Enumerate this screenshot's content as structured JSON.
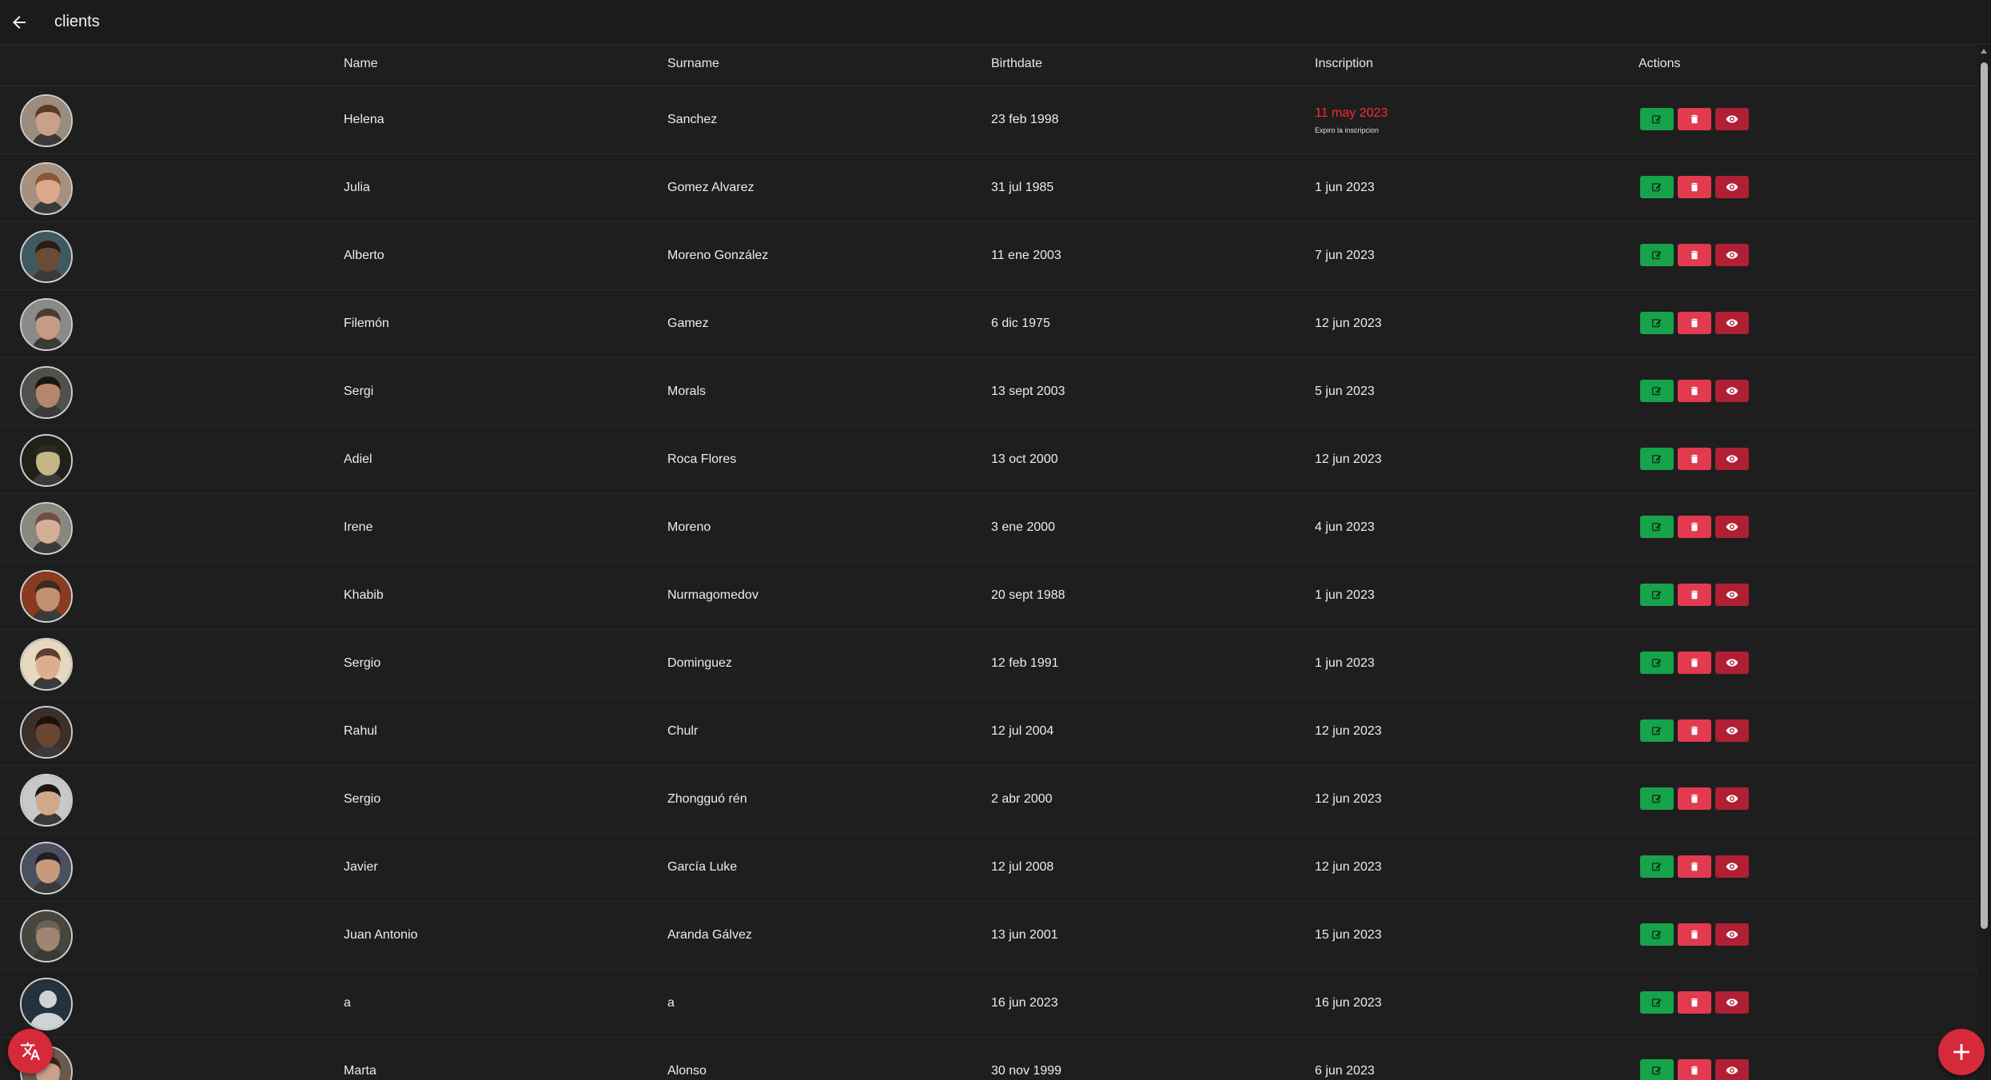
{
  "header": {
    "title": "clients",
    "back_icon": "arrow-left-icon"
  },
  "table": {
    "columns": [
      "Name",
      "Surname",
      "Birthdate",
      "Inscription",
      "Actions"
    ],
    "rows": [
      {
        "name": "Helena",
        "surname": "Sanchez",
        "birthdate": "23 feb 1998",
        "inscription": "11 may 2023",
        "expired": true,
        "note": "Expiro la inscripcion",
        "skin": "#c9a089",
        "hair": "#5a3a22",
        "bg": "#9c8c7e"
      },
      {
        "name": "Julia",
        "surname": "Gomez Alvarez",
        "birthdate": "31 jul 1985",
        "inscription": "1 jun 2023",
        "expired": false,
        "note": "",
        "skin": "#d9a98c",
        "hair": "#8a5a32",
        "bg": "#a5917d"
      },
      {
        "name": "Alberto",
        "surname": "Moreno González",
        "birthdate": "11 ene 2003",
        "inscription": "7 jun 2023",
        "expired": false,
        "note": "",
        "skin": "#6d4a36",
        "hair": "#2a1c14",
        "bg": "#3e5a60"
      },
      {
        "name": "Filemón",
        "surname": "Gamez",
        "birthdate": "6 dic 1975",
        "inscription": "12 jun 2023",
        "expired": false,
        "note": "",
        "skin": "#c79a82",
        "hair": "#4a3a30",
        "bg": "#8a8a88"
      },
      {
        "name": "Sergi",
        "surname": "Morals",
        "birthdate": "13 sept 2003",
        "inscription": "5 jun 2023",
        "expired": false,
        "note": "",
        "skin": "#b5876a",
        "hair": "#1c1410",
        "bg": "#50504c"
      },
      {
        "name": "Adiel",
        "surname": "Roca Flores",
        "birthdate": "13 oct 2000",
        "inscription": "12 jun 2023",
        "expired": false,
        "note": "",
        "skin": "#c4b486",
        "hair": "#2a2a22",
        "bg": "#1e2218"
      },
      {
        "name": "Irene",
        "surname": "Moreno",
        "birthdate": "3 ene 2000",
        "inscription": "4 jun 2023",
        "expired": false,
        "note": "",
        "skin": "#d6ad96",
        "hair": "#6e5040",
        "bg": "#8a8680"
      },
      {
        "name": "Khabib",
        "surname": "Nurmagomedov",
        "birthdate": "20 sept 1988",
        "inscription": "1 jun 2023",
        "expired": false,
        "note": "",
        "skin": "#c09070",
        "hair": "#3a2a20",
        "bg": "#8a3a1e"
      },
      {
        "name": "Sergio",
        "surname": "Dominguez",
        "birthdate": "12 feb 1991",
        "inscription": "1 jun 2023",
        "expired": false,
        "note": "",
        "skin": "#dcae90",
        "hair": "#5a4030",
        "bg": "#e8d8c0"
      },
      {
        "name": "Rahul",
        "surname": "Chulr",
        "birthdate": "12 jul 2004",
        "inscription": "12 jun 2023",
        "expired": false,
        "note": "",
        "skin": "#6a4632",
        "hair": "#1a1210",
        "bg": "#3a3028"
      },
      {
        "name": "Sergio",
        "surname": "Zhongguó rén",
        "birthdate": "2 abr 2000",
        "inscription": "12 jun 2023",
        "expired": false,
        "note": "",
        "skin": "#d2a88a",
        "hair": "#1c1612",
        "bg": "#c8c8c8"
      },
      {
        "name": "Javier",
        "surname": "García Luke",
        "birthdate": "12 jul 2008",
        "inscription": "12 jun 2023",
        "expired": false,
        "note": "",
        "skin": "#c89a7a",
        "hair": "#202024",
        "bg": "#4a5060"
      },
      {
        "name": "Juan Antonio",
        "surname": "Aranda Gálvez",
        "birthdate": "13 jun 2001",
        "inscription": "15 jun 2023",
        "expired": false,
        "note": "",
        "skin": "#a08670",
        "hair": "#6a6056",
        "bg": "#48443e"
      },
      {
        "name": "a",
        "surname": "a",
        "birthdate": "16 jun 2023",
        "inscription": "16 jun 2023",
        "expired": false,
        "note": "",
        "skin": "#cfd3d8",
        "hair": "#cfd3d8",
        "bg": "#263140",
        "default_avatar": true
      },
      {
        "name": "Marta",
        "surname": "Alonso",
        "birthdate": "30 nov 1999",
        "inscription": "6 jun 2023",
        "expired": false,
        "note": "",
        "skin": "#c9a08a",
        "hair": "#3a2418",
        "bg": "#6a5a4e"
      }
    ]
  },
  "actions": {
    "edit_icon": "edit-icon",
    "delete_icon": "trash-icon",
    "view_icon": "eye-icon",
    "edit_color": "#16a34a",
    "delete_color": "#e23a4f",
    "view_color": "#b01f33"
  },
  "fabs": {
    "language_icon": "translate-icon",
    "add_icon": "plus-icon",
    "color": "#d6293a"
  },
  "colors": {
    "background": "#1e1e1f",
    "expired_text": "#ff2b2b"
  }
}
